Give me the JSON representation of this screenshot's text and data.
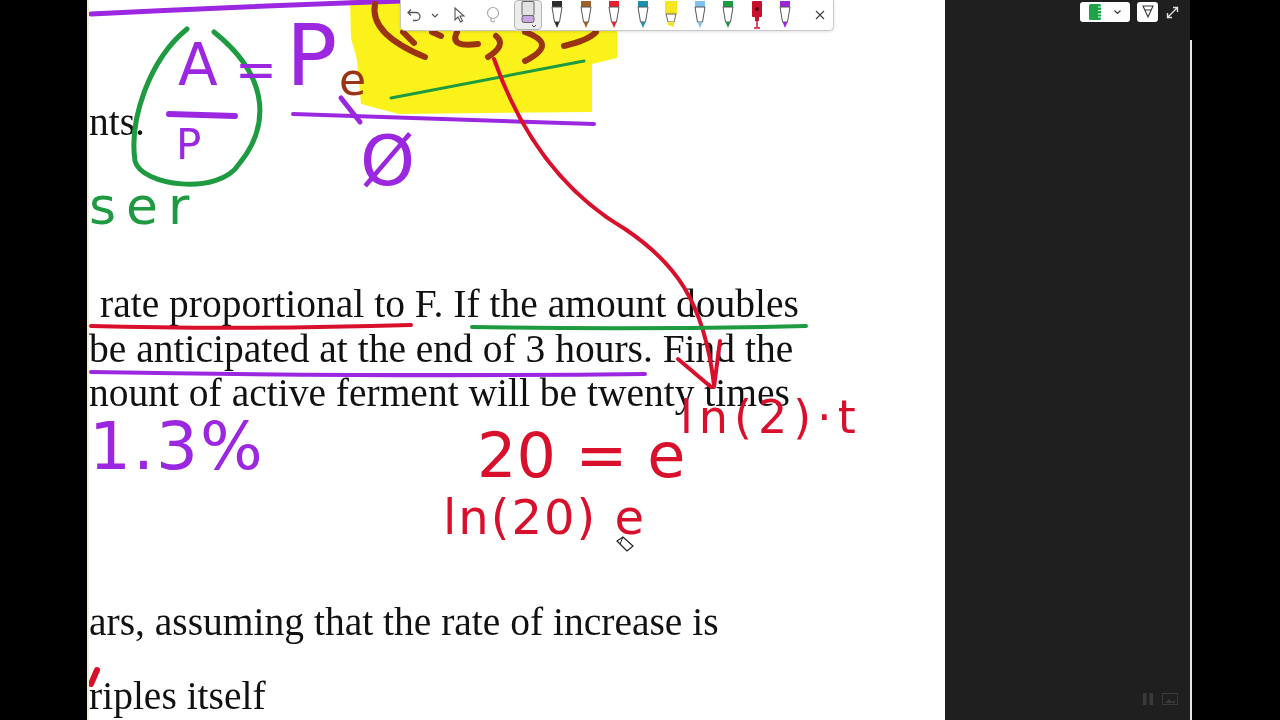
{
  "toolbar": {
    "tools": [
      {
        "kind": "select",
        "selected": false
      },
      {
        "kind": "lasso",
        "selected": false
      },
      {
        "kind": "eraser",
        "selected": true
      },
      {
        "kind": "pen",
        "color": "#2b2b2b",
        "selected": false
      },
      {
        "kind": "pen",
        "color": "#a0622d",
        "selected": false
      },
      {
        "kind": "pen",
        "color": "#e8202f",
        "selected": false
      },
      {
        "kind": "pen",
        "color": "#1c8fae",
        "selected": false
      },
      {
        "kind": "highlighter",
        "color": "#f5e61e",
        "selected": false
      },
      {
        "kind": "pen",
        "color": "#7cc1f2",
        "selected": false
      },
      {
        "kind": "pen",
        "color": "#1e9a40",
        "selected": false
      },
      {
        "kind": "marker",
        "color": "#c8102e",
        "selected": false
      },
      {
        "kind": "pen",
        "color": "#9a28d8",
        "selected": false
      }
    ]
  },
  "page": {
    "lines": [
      "nts.",
      "rate proportional to F. If the amount doubles",
      "be anticipated at the end of 3 hours. Find the",
      "nount of active ferment will be twenty times",
      "ars, assuming that the rate of increase is",
      "riples itself"
    ],
    "ink_text": [
      {
        "text": "A",
        "color": "#9b27e0"
      },
      {
        "text": "P",
        "color": "#9b27e0"
      },
      {
        "text": "=",
        "color": "#9b27e0"
      },
      {
        "text": "P",
        "color": "#9b27e0"
      },
      {
        "text": "e",
        "color": "#9a3412"
      },
      {
        "text": "Ø",
        "color": "#9b27e0"
      },
      {
        "text": "ser",
        "color": "#1e9a40"
      },
      {
        "text": "1.3%",
        "color": "#9b27e0"
      },
      {
        "text": "20 = e",
        "color": "#d8102c"
      },
      {
        "text": "ln(2)·t",
        "color": "#d8102c"
      },
      {
        "text": "ln(20) e",
        "color": "#d8102c"
      }
    ]
  }
}
